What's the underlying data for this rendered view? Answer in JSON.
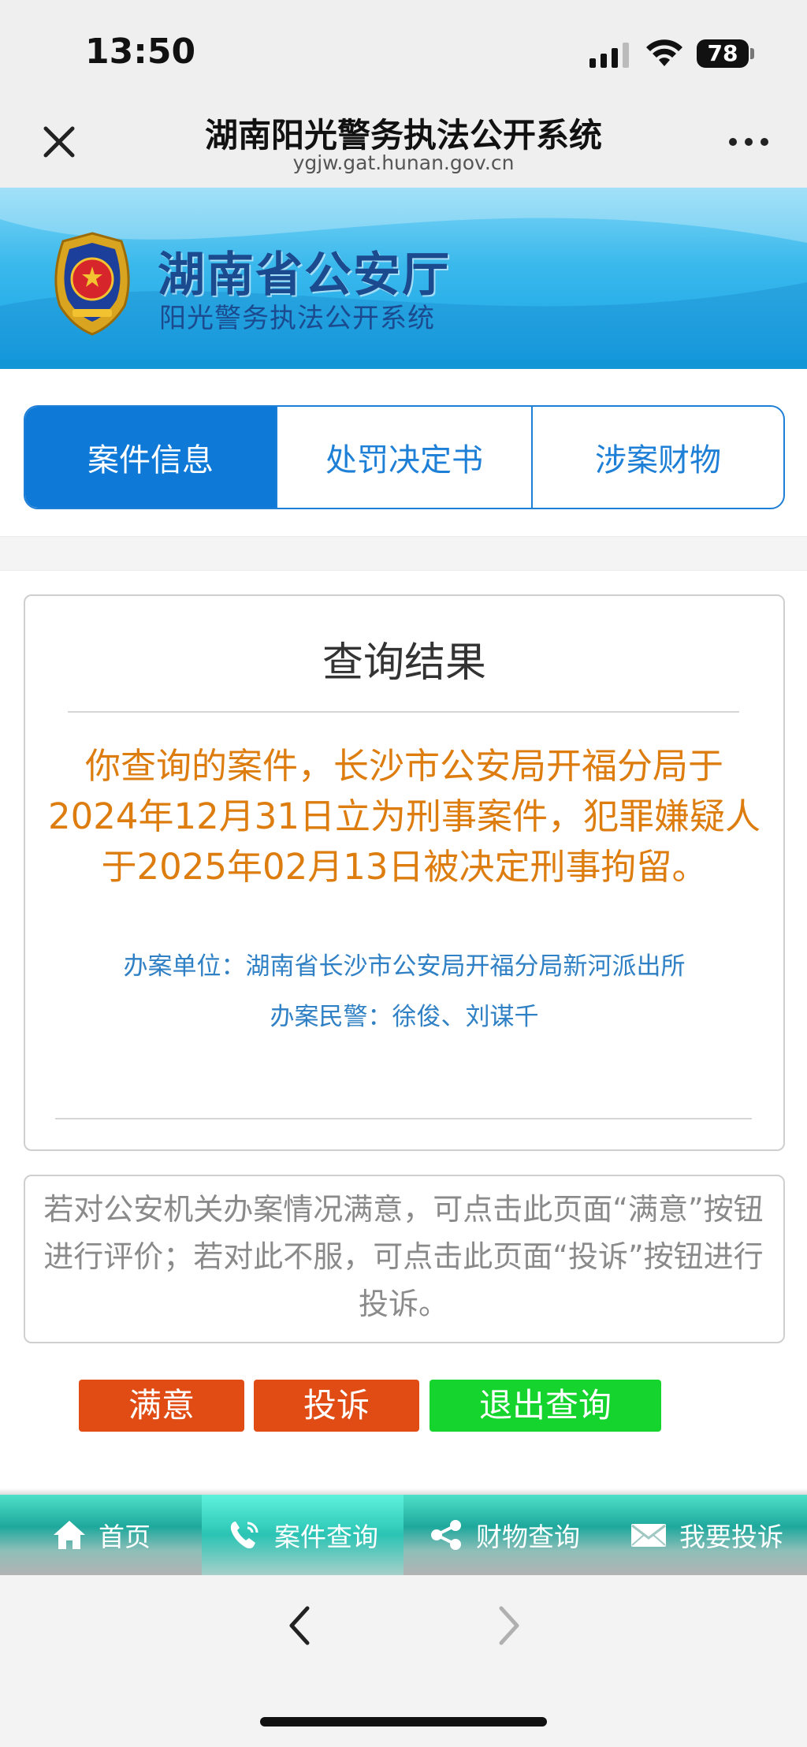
{
  "status_bar": {
    "time": "13:50",
    "battery": "78"
  },
  "browser": {
    "title": "湖南阳光警务执法公开系统",
    "domain": "ygjw.gat.hunan.gov.cn"
  },
  "banner": {
    "title": "湖南省公安厅",
    "subtitle": "阳光警务执法公开系统"
  },
  "tabs": [
    {
      "label": "案件信息",
      "active": true
    },
    {
      "label": "处罚决定书",
      "active": false
    },
    {
      "label": "涉案财物",
      "active": false
    }
  ],
  "result": {
    "title": "查询结果",
    "text": "你查询的案件，长沙市公安局开福分局于2024年12月31日立为刑事案件，犯罪嫌疑人于2025年02月13日被决定刑事拘留。",
    "office_unit": "办案单位：湖南省长沙市公安局开福分局新河派出所",
    "officers": "办案民警：徐俊、刘谋千"
  },
  "notice": "若对公安机关办案情况满意，可点击此页面“满意”按钮进行评价；若对此不服，可点击此页面“投诉”按钮进行投诉。",
  "actions": {
    "satisfied": "满意",
    "complain": "投诉",
    "exit": "退出查询"
  },
  "bottom_nav": [
    {
      "label": "首页",
      "icon": "home-icon"
    },
    {
      "label": "案件查询",
      "icon": "phone-icon",
      "active": true
    },
    {
      "label": "财物查询",
      "icon": "share-icon"
    },
    {
      "label": "我要投诉",
      "icon": "mail-icon"
    }
  ],
  "colors": {
    "accent": "#0f79d8",
    "result_text": "#dd7d10",
    "info_text": "#2f80c4",
    "button_red": "#e04c14",
    "button_green": "#16d42e"
  }
}
